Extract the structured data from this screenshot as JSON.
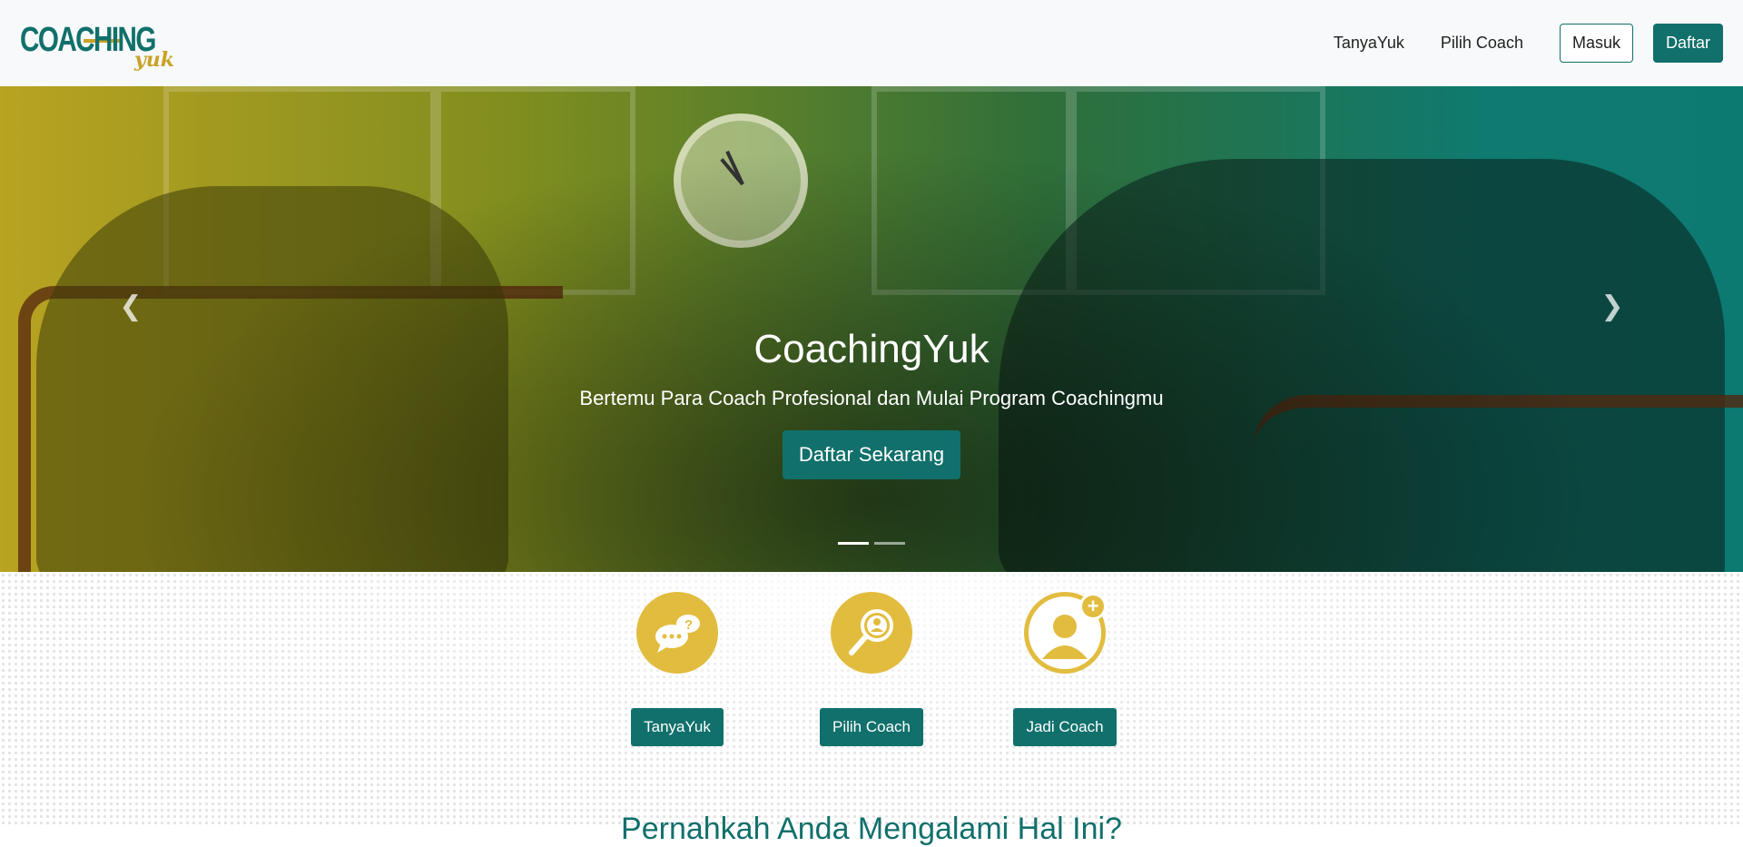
{
  "brand": {
    "logo_main": "COACHING",
    "logo_sub": "yuk",
    "primary_color": "#11706b",
    "accent_color": "#e2bc3e"
  },
  "nav": {
    "links": [
      "TanyaYuk",
      "Pilih Coach"
    ],
    "login_label": "Masuk",
    "register_label": "Daftar"
  },
  "hero": {
    "title": "CoachingYuk",
    "subtitle": "Bertemu Para Coach Profesional dan Mulai Program Coachingmu",
    "cta_label": "Daftar Sekarang",
    "prev_icon": "chevron-left-icon",
    "next_icon": "chevron-right-icon",
    "slides_count": 2,
    "active_slide": 1
  },
  "features": [
    {
      "label": "TanyaYuk",
      "icon": "chat-question-icon"
    },
    {
      "label": "Pilih Coach",
      "icon": "search-person-icon"
    },
    {
      "label": "Jadi Coach",
      "icon": "user-add-icon"
    }
  ],
  "section": {
    "heading": "Pernahkah Anda Mengalami Hal Ini?"
  }
}
